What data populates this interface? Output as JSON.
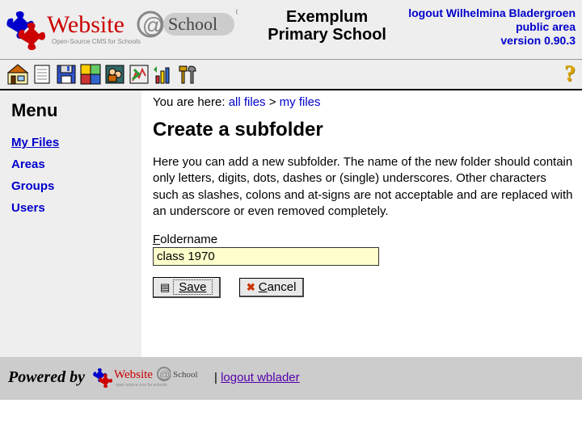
{
  "header": {
    "school_name_line1": "Exemplum",
    "school_name_line2": "Primary School",
    "logout_label": "logout Wilhelmina Bladergroen",
    "public_area": "public area",
    "version": "version 0.90.3"
  },
  "toolbar": {
    "icons": [
      "home",
      "page",
      "save",
      "modules",
      "accounts",
      "config",
      "stats",
      "tools"
    ]
  },
  "sidebar": {
    "title": "Menu",
    "items": [
      {
        "label": "My Files",
        "active": true
      },
      {
        "label": "Areas",
        "active": false
      },
      {
        "label": "Groups",
        "active": false
      },
      {
        "label": "Users",
        "active": false
      }
    ]
  },
  "breadcrumb": {
    "prefix": "You are here: ",
    "link1": "all files",
    "sep": " > ",
    "link2": "my files"
  },
  "page": {
    "title": "Create a subfolder",
    "description": "Here you can add a new subfolder. The name of the new folder should contain only letters, digits, dots, dashes or (single) underscores. Other characters such as slashes, colons and at-signs are not acceptable and are replaced with an underscore or even removed completely.",
    "field_hotkey": "F",
    "field_rest": "oldername",
    "field_value": "class 1970",
    "save_label": "Save",
    "cancel_hot": "C",
    "cancel_rest": "ancel"
  },
  "footer": {
    "powered": "Powered by",
    "sep": "|",
    "logout": "logout wblader"
  }
}
